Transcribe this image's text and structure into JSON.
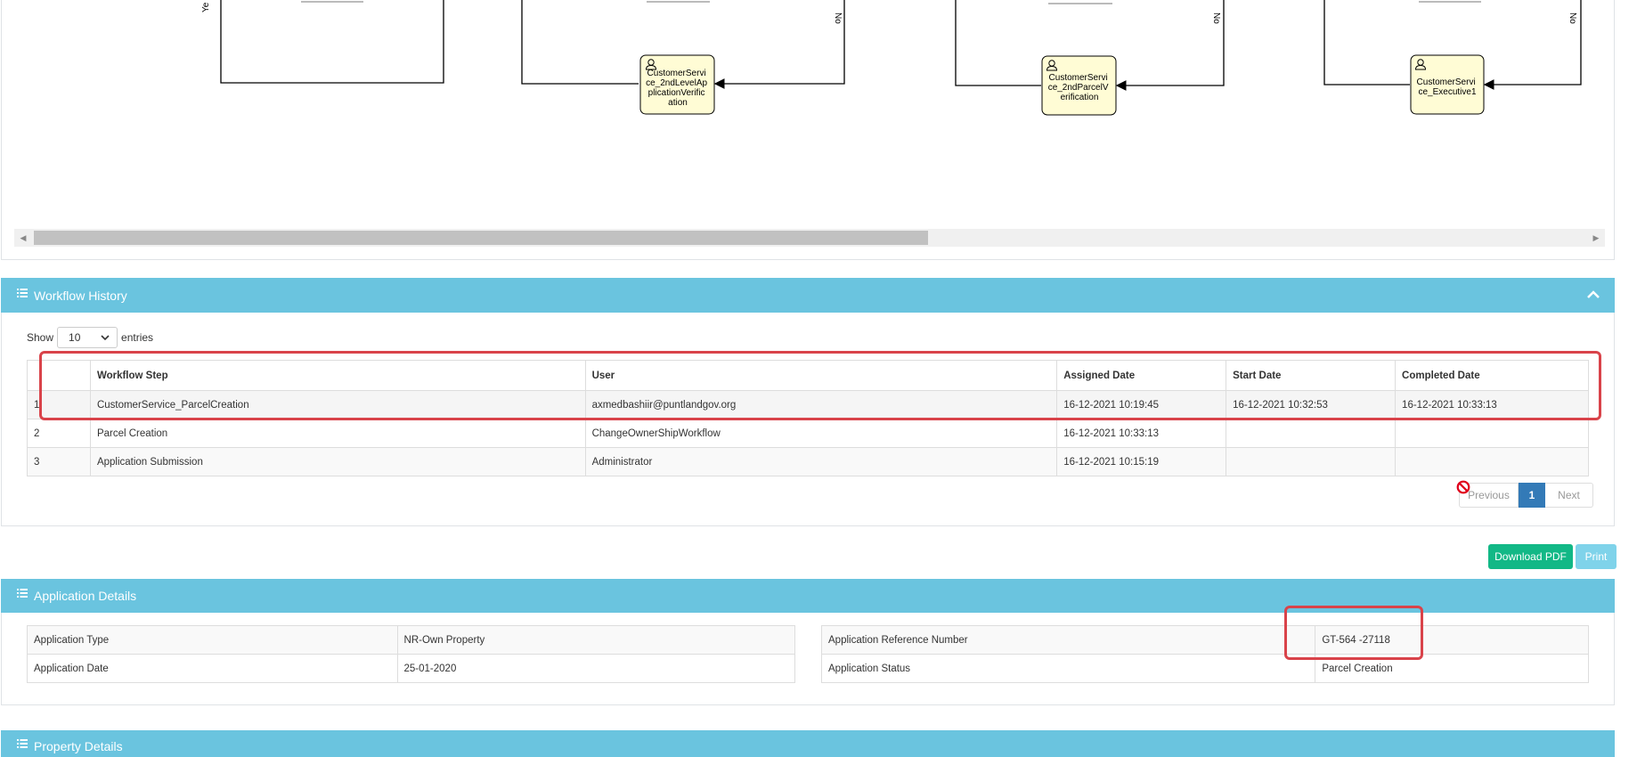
{
  "diagram": {
    "tasks": [
      {
        "label": "CustomerService_2ndLevelApplicationVerification",
        "lines": [
          "CustomerServi",
          "ce_2ndLevelAp",
          "plicationVerific",
          "ation"
        ]
      },
      {
        "label": "CustomerService_2ndParcelVerification",
        "lines": [
          "CustomerServi",
          "ce_2ndParcelV",
          "erification"
        ]
      },
      {
        "label": "CustomerService_Executive1",
        "lines": [
          "CustomerServi",
          "ce_Executive1"
        ]
      }
    ],
    "edge_labels": [
      "Ye",
      "No",
      "No",
      "No"
    ]
  },
  "workflow_history": {
    "title": "Workflow History",
    "show_label": "Show",
    "entries_label": "entries",
    "page_length": "10",
    "columns": [
      "",
      "Workflow Step",
      "User",
      "Assigned Date",
      "Start Date",
      "Completed Date"
    ],
    "rows": [
      [
        "1",
        "CustomerService_ParcelCreation",
        "axmedbashiir@puntlandgov.org",
        "16-12-2021 10:19:45",
        "16-12-2021 10:32:53",
        "16-12-2021 10:33:13"
      ],
      [
        "2",
        "Parcel Creation",
        "ChangeOwnerShipWorkflow",
        "16-12-2021 10:33:13",
        "",
        ""
      ],
      [
        "3",
        "Application Submission",
        "Administrator",
        "16-12-2021 10:15:19",
        "",
        ""
      ]
    ],
    "pagination": {
      "previous": "Previous",
      "current": "1",
      "next": "Next"
    }
  },
  "actions": {
    "download_pdf": "Download PDF",
    "print": "Print"
  },
  "application_details": {
    "title": "Application Details",
    "left": [
      [
        "Application Type",
        "NR-Own Property"
      ],
      [
        "Application Date",
        "25-01-2020"
      ]
    ],
    "right": [
      [
        "Application Reference Number",
        "GT-564 -27118"
      ],
      [
        "Application Status",
        "Parcel Creation"
      ]
    ]
  },
  "property_details": {
    "title": "Property Details"
  },
  "colors": {
    "panel_header": "#6ac4df",
    "highlight": "#d9434a",
    "primary": "#337ab7",
    "success": "#12b886",
    "task_fill": "#fffcd5"
  }
}
